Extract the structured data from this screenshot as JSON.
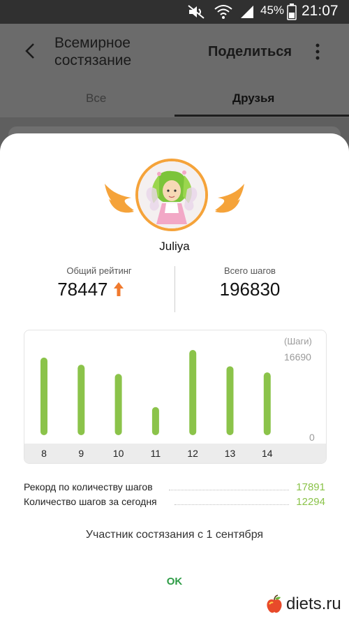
{
  "status_bar": {
    "battery": "45%",
    "time": "21:07",
    "icons": [
      "mute-icon",
      "wifi-icon",
      "signal-icon",
      "battery-icon"
    ]
  },
  "header": {
    "title": "Всемирное состязание",
    "share_label": "Поделиться",
    "icons": [
      "back-arrow-icon",
      "more-vert-icon"
    ]
  },
  "tabs": [
    {
      "label": "Все",
      "selected": false
    },
    {
      "label": "Друзья",
      "selected": true
    }
  ],
  "dialog": {
    "username": "Juliya",
    "rating": {
      "label": "Общий рейтинг",
      "value": "78447",
      "trend": "up",
      "trend_color": "#f07a2e"
    },
    "total_steps": {
      "label": "Всего шагов",
      "value": "196830"
    },
    "chart": {
      "unit_label": "(Шаги)",
      "max_label": "16690",
      "min_label": "0"
    },
    "record": {
      "label": "Рекорд по количеству шагов",
      "value": "17891"
    },
    "today": {
      "label": "Количество шагов за сегодня",
      "value": "12294"
    },
    "member_since": "Участник состязания с 1 сентября",
    "ok_label": "OK"
  },
  "chart_data": {
    "type": "bar",
    "categories": [
      "8",
      "9",
      "10",
      "11",
      "12",
      "13",
      "14"
    ],
    "values": [
      15200,
      13800,
      12000,
      5500,
      16690,
      13500,
      12294
    ],
    "ylim": [
      0,
      16690
    ],
    "ylabel": "(Шаги)",
    "bar_color": "#8bc34a"
  },
  "watermark": {
    "text": "diets.ru"
  },
  "colors": {
    "accent_green": "#8bc34a",
    "ok_green": "#2e9c46",
    "wing_orange": "#f5a33a"
  }
}
